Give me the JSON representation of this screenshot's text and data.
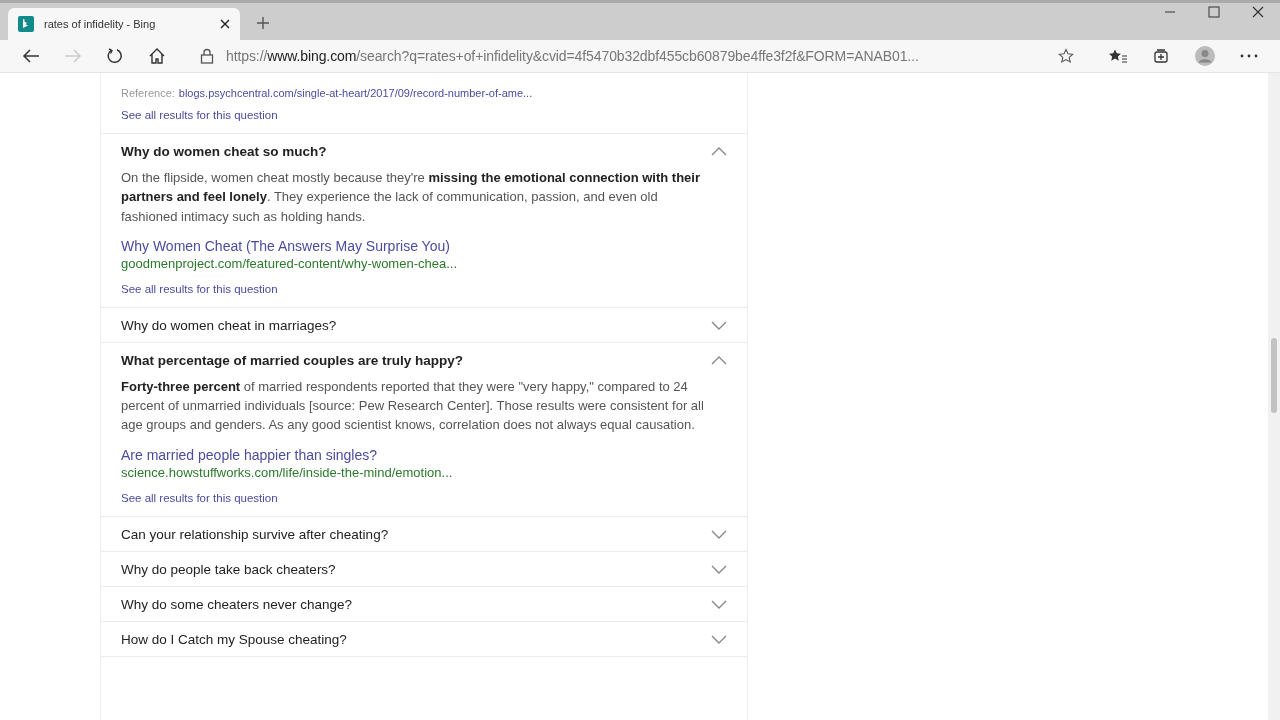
{
  "browser": {
    "tab": {
      "title": "rates of infidelity - Bing",
      "selected": true
    },
    "address": {
      "scheme": "https://",
      "host": "www.bing.com",
      "path": "/search?q=rates+of+infidelity&cvid=4f5470b32dbf455cb60879be4ffe3f2f&FORM=ANAB01..."
    }
  },
  "top_fragment": {
    "reference_label": "Reference:",
    "reference_url": "blogs.psychcentral.com/single-at-heart/2017/09/record-number-of-ame...",
    "see_all": "See all results for this question"
  },
  "questions": [
    {
      "question": "Why do women cheat so much?",
      "expanded": true,
      "answer": "On the flipside, women cheat mostly because they're **missing the emotional connection with their partners and feel lonely**. They experience the lack of communication, passion, and even old fashioned intimacy such as holding hands.",
      "link_title": "Why Women Cheat (The Answers May Surprise You)",
      "link_url": "goodmenproject.com/featured-content/why-women-chea...",
      "see_all": "See all results for this question"
    },
    {
      "question": "Why do women cheat in marriages?",
      "expanded": false
    },
    {
      "question": "What percentage of married couples are truly happy?",
      "expanded": true,
      "answer": "**Forty-three percent** of married respondents reported that they were \"very happy,\" compared to 24 percent of unmarried individuals [source: Pew Research Center]. Those results were consistent for all age groups and genders. As any good scientist knows, correlation does not always equal causation.",
      "link_title": "Are married people happier than singles?",
      "link_url": "science.howstuffworks.com/life/inside-the-mind/emotion...",
      "see_all": "See all results for this question"
    },
    {
      "question": "Can your relationship survive after cheating?",
      "expanded": false
    },
    {
      "question": "Why do people take back cheaters?",
      "expanded": false
    },
    {
      "question": "Why do some cheaters never change?",
      "expanded": false
    },
    {
      "question": "How do I Catch my Spouse cheating?",
      "expanded": false
    }
  ]
}
